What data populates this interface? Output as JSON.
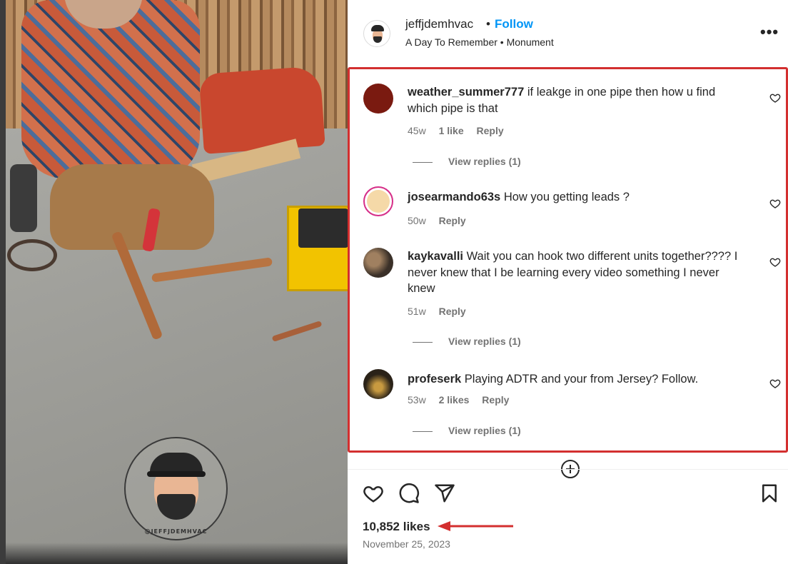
{
  "post": {
    "username": "jeffjdemhvac",
    "separator": "•",
    "follow_label": "Follow",
    "audio": "A Day To Remember • Monument",
    "more_label": "•••",
    "watermark": "@JEFFJDEMHVAC"
  },
  "comments": [
    {
      "username": "weather_summer777",
      "text": "if leakge in one pipe then how u find which pipe is that",
      "age": "45w",
      "likes": "1 like",
      "reply_label": "Reply",
      "view_replies": "View replies (1)"
    },
    {
      "username": "josearmando63s",
      "text": "How you getting leads ?",
      "age": "50w",
      "reply_label": "Reply"
    },
    {
      "username": "kaykavalli",
      "text": "Wait you can hook two different units together???? I never knew that I be learning every video something I never knew",
      "age": "51w",
      "reply_label": "Reply",
      "view_replies": "View replies (1)"
    },
    {
      "username": "profeserk",
      "text": "Playing ADTR and your from Jersey? Follow.",
      "age": "53w",
      "likes": "2 likes",
      "reply_label": "Reply",
      "view_replies": "View replies (1)"
    }
  ],
  "footer": {
    "likes_count": "10,852 likes",
    "date": "November 25, 2023"
  },
  "icons": {
    "like": "heart-icon",
    "comment": "comment-icon",
    "share": "share-icon",
    "save": "bookmark-icon",
    "load_more": "plus-circle-icon",
    "more": "more-icon"
  },
  "colors": {
    "follow": "#0095f6",
    "annotation": "#d32f2f",
    "text_primary": "#262626",
    "text_secondary": "#737373"
  }
}
